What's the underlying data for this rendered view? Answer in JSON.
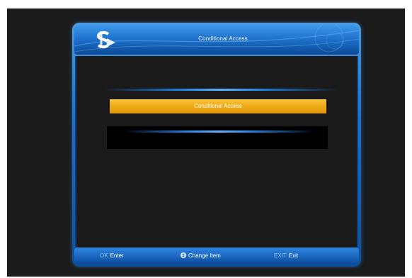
{
  "window": {
    "title": "Conditional Access"
  },
  "menu": {
    "items": [
      {
        "label": "Conditional Access",
        "selected": true
      }
    ]
  },
  "footer": {
    "ok": {
      "key": "OK",
      "label": "Enter"
    },
    "change": {
      "icon": "up-down-icon",
      "label": "Change Item"
    },
    "exit": {
      "key": "EXIT",
      "label": "Exit"
    }
  },
  "colors": {
    "frame_blue": "#1f6fc4",
    "highlight_yellow": "#efaa16",
    "background": "#1a1a1a"
  }
}
